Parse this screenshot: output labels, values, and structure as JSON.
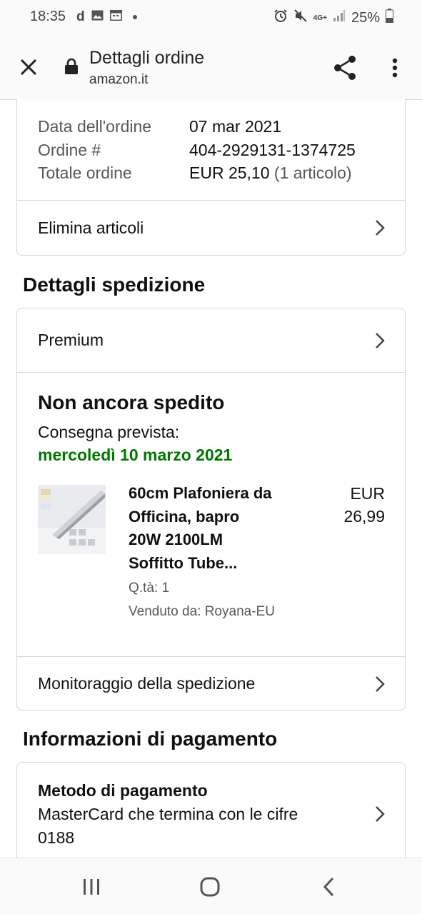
{
  "status_bar": {
    "time": "18:35",
    "left_icons": [
      "d-icon",
      "image-icon",
      "calendar-icon",
      "dot-icon"
    ],
    "right_icons": [
      "alarm-icon",
      "mute-icon",
      "signal-icon"
    ],
    "network": "4G+",
    "battery": "25%"
  },
  "browser": {
    "title": "Dettagli ordine",
    "domain": "amazon.it",
    "icons": {
      "close": "close-icon",
      "lock": "lock-icon",
      "share": "share-icon",
      "menu": "more-vert-icon"
    }
  },
  "order_summary": {
    "rows": [
      {
        "label": "Data dell'ordine",
        "value": "07 mar 2021",
        "extra": ""
      },
      {
        "label": "Ordine #",
        "value": "404-2929131-1374725",
        "extra": ""
      },
      {
        "label": "Totale ordine",
        "value": "EUR 25,10",
        "extra": "(1 articolo)"
      }
    ],
    "delete_link": "Elimina articoli"
  },
  "shipping": {
    "section_title": "Dettagli spedizione",
    "speed": "Premium",
    "status": "Non ancora spedito",
    "delivery_label": "Consegna prevista:",
    "delivery_date": "mercoledì 10 marzo 2021",
    "delivery_date_color": "#007600",
    "item": {
      "title_lines": [
        "60cm Plafoniera da",
        "Officina, bapro",
        "20W 2100LM",
        "Soffitto Tube..."
      ],
      "price_currency": "EUR",
      "price_value": "26,99",
      "quantity": "Q.tà: 1",
      "seller": "Venduto da: Royana-EU"
    },
    "tracking_link": "Monitoraggio della spedizione"
  },
  "payment": {
    "section_title": "Informazioni di pagamento",
    "method_title": "Metodo di pagamento",
    "method_lines": [
      "MasterCard che termina con le cifre",
      "0188"
    ]
  },
  "nav": {
    "recent": "recents-icon",
    "home": "home-icon",
    "back": "back-icon"
  }
}
